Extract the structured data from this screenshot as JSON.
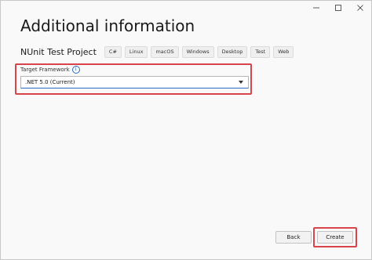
{
  "window": {
    "title": "Additional information",
    "caption_buttons": [
      {
        "name": "minimize",
        "glyph": "—"
      },
      {
        "name": "maximize",
        "glyph": "☐"
      },
      {
        "name": "close",
        "glyph": "✕"
      }
    ]
  },
  "project": {
    "name": "NUnit Test Project",
    "tags": [
      "C#",
      "Linux",
      "macOS",
      "Windows",
      "Desktop",
      "Test",
      "Web"
    ]
  },
  "framework": {
    "label": "Target Framework",
    "info_icon": "info-icon",
    "selected": ".NET 5.0 (Current)"
  },
  "footer": {
    "back_label": "Back",
    "create_label": "Create"
  },
  "colors": {
    "highlight": "#d9434a",
    "accent": "#2b6cc4"
  }
}
